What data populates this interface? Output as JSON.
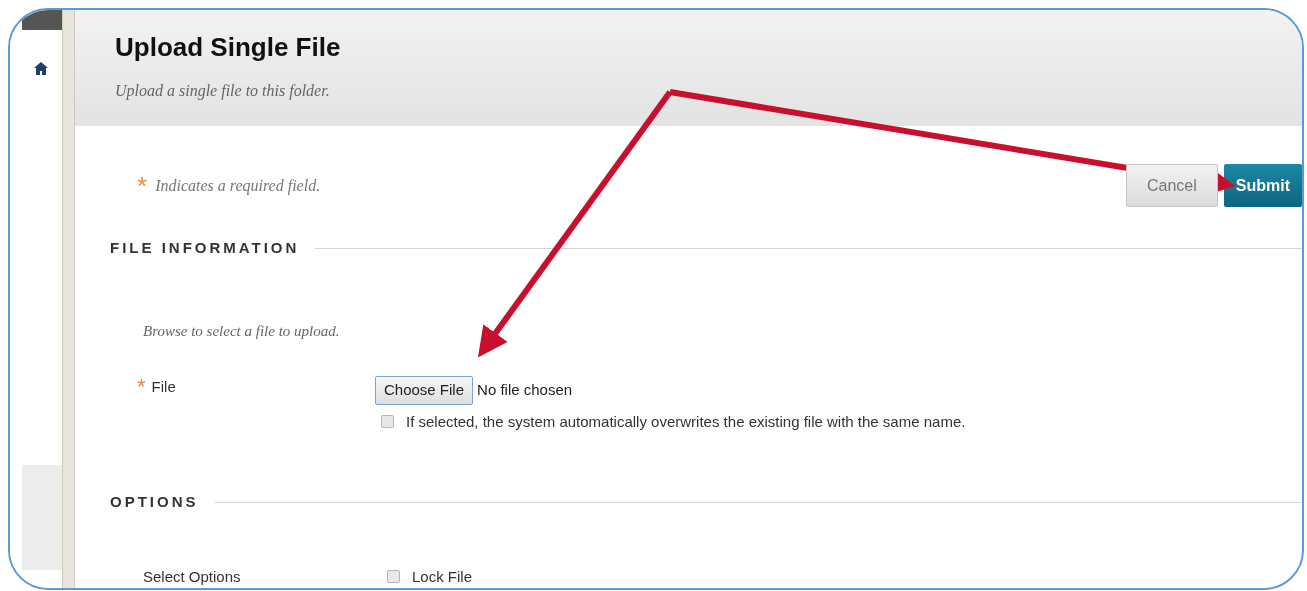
{
  "header": {
    "title": "Upload Single File",
    "subtitle": "Upload a single file to this folder."
  },
  "required_note": {
    "marker": "*",
    "text": "Indicates a required field."
  },
  "buttons": [
    {
      "label": "Cancel",
      "kind": "secondary"
    },
    {
      "label": "Submit",
      "kind": "primary"
    }
  ],
  "file_section": {
    "heading": "FILE INFORMATION",
    "instructions": "Browse to select a file to upload.",
    "label": "File",
    "required_marker": "*",
    "choose_button": "Choose File",
    "file_status": "No file chosen",
    "overwrite": {
      "label": "If selected, the system automatically overwrites the existing file with the same name.",
      "checked": false
    }
  },
  "options_section": {
    "heading": "OPTIONS",
    "label": "Select Options",
    "options": [
      {
        "label": "Lock File",
        "checked": false
      }
    ]
  }
}
